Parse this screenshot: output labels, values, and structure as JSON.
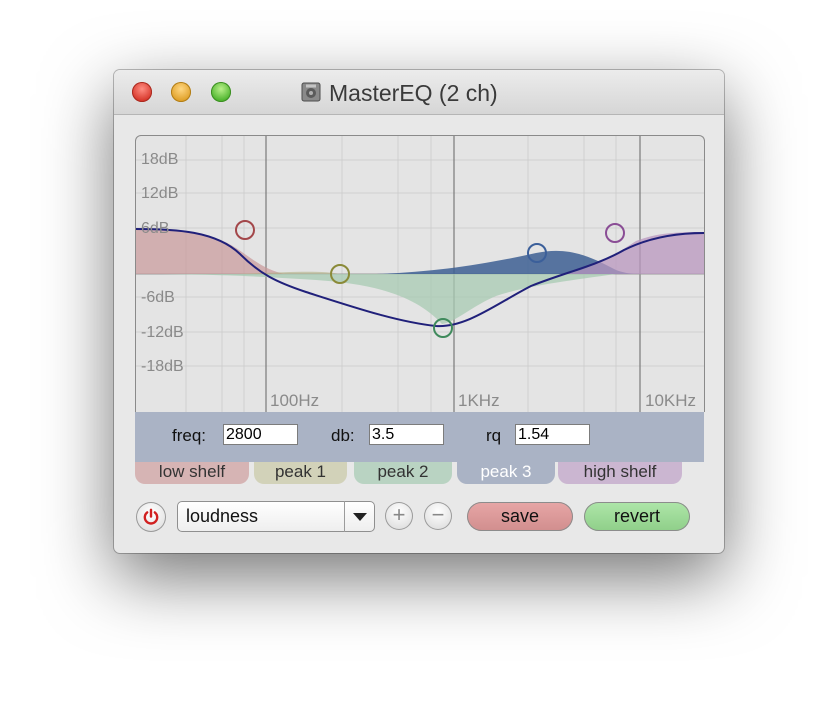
{
  "window": {
    "title": "MasterEQ (2 ch)",
    "traffic_lights": [
      "close",
      "minimize",
      "zoom"
    ]
  },
  "graph": {
    "db_labels": [
      "18dB",
      "12dB",
      "6dB",
      "-6dB",
      "-12dB",
      "-18dB"
    ],
    "freq_labels": [
      "100Hz",
      "1KHz",
      "10KHz"
    ]
  },
  "params": {
    "freq_label": "freq:",
    "freq_value": "2800",
    "db_label": "db:",
    "db_value": "3.5",
    "rq_label": "rq",
    "rq_value": "1.54"
  },
  "bands": [
    {
      "label": "low shelf",
      "color": "#d6b4b4"
    },
    {
      "label": "peak 1",
      "color": "#d2d2b9"
    },
    {
      "label": "peak 2",
      "color": "#b9d3c2"
    },
    {
      "label": "peak 3",
      "color": "#aab3c5",
      "selected": true
    },
    {
      "label": "high shelf",
      "color": "#cbb6d1"
    }
  ],
  "toolbar": {
    "preset_value": "loudness",
    "add_symbol": "+",
    "remove_symbol": "−",
    "save_label": "save",
    "revert_label": "revert",
    "power_icon": "power-icon",
    "power_color": "#d12020"
  }
}
